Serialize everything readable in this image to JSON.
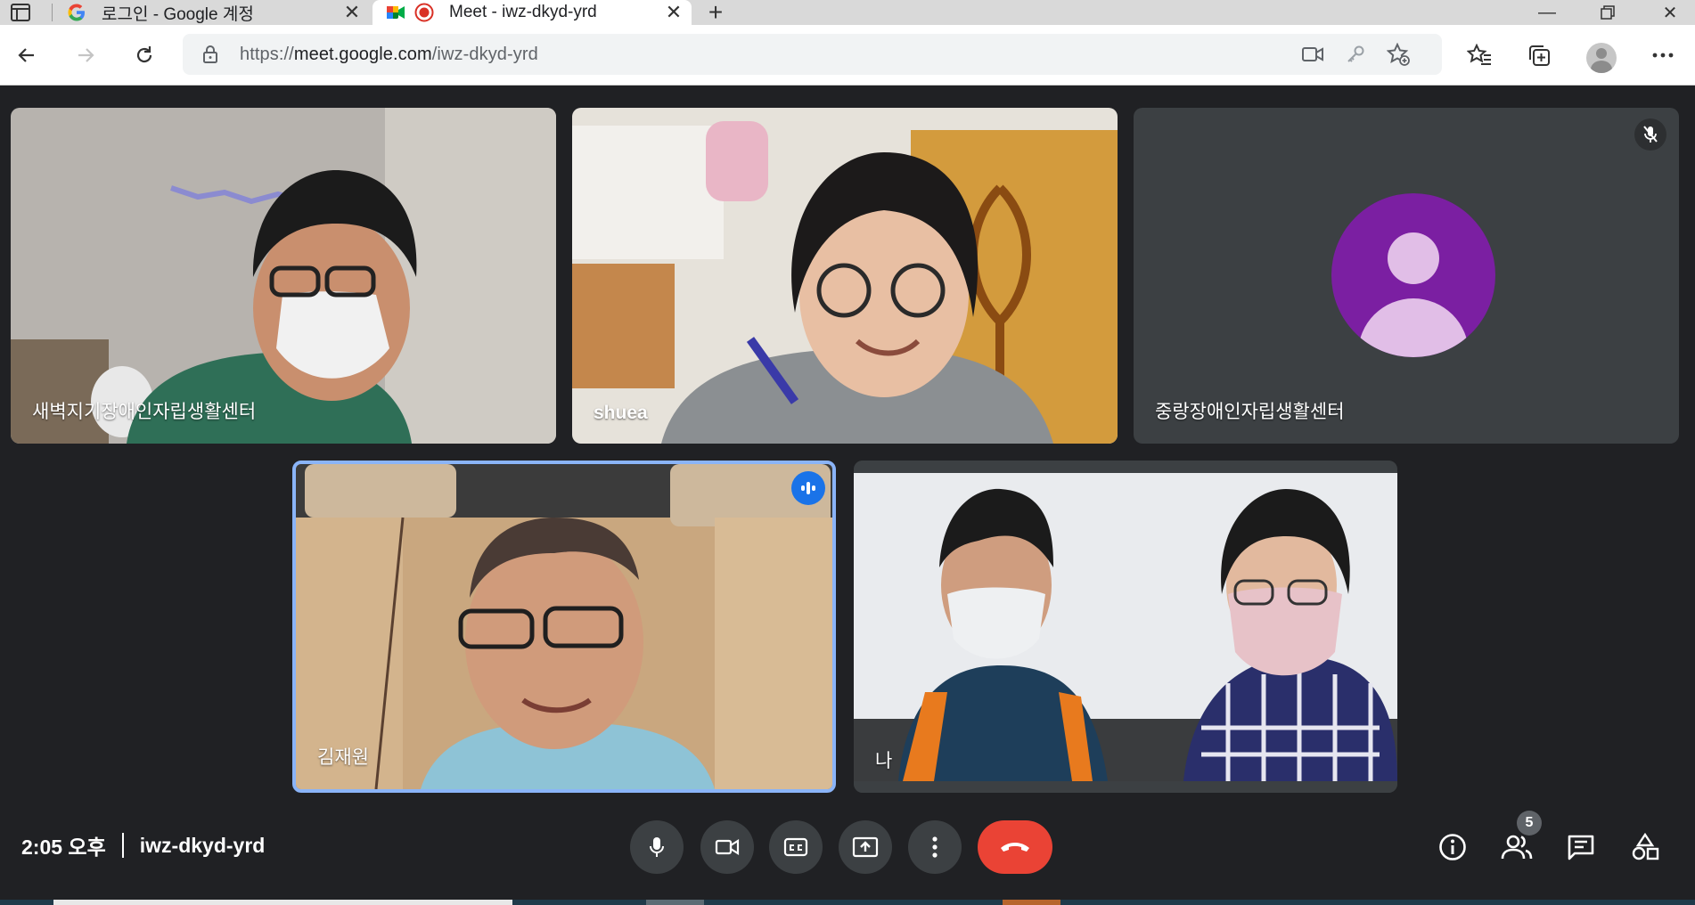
{
  "browser": {
    "tabs": [
      {
        "title": "로그인 - Google 계정",
        "active": false
      },
      {
        "title": "Meet - iwz-dkyd-yrd",
        "active": true
      }
    ],
    "url_prefix": "https://",
    "url_host": "meet.google.com",
    "url_path": "/iwz-dkyd-yrd"
  },
  "participants": [
    {
      "name": "새벽지기장애인자립생활센터",
      "state": "video"
    },
    {
      "name": "shuea",
      "state": "video"
    },
    {
      "name": "중랑장애인자립생활센터",
      "state": "avatar",
      "muted": true,
      "avatar_color": "#7b1fa2"
    },
    {
      "name": "김재원",
      "state": "video",
      "speaking": true
    },
    {
      "name": "나",
      "state": "video"
    }
  ],
  "bottom_bar": {
    "time": "2:05 오후",
    "meeting_code": "iwz-dkyd-yrd",
    "people_count": "5"
  },
  "colors": {
    "background": "#202124",
    "leave": "#ea4335",
    "active_border": "#8ab4f8",
    "speaking": "#1a73e8"
  }
}
